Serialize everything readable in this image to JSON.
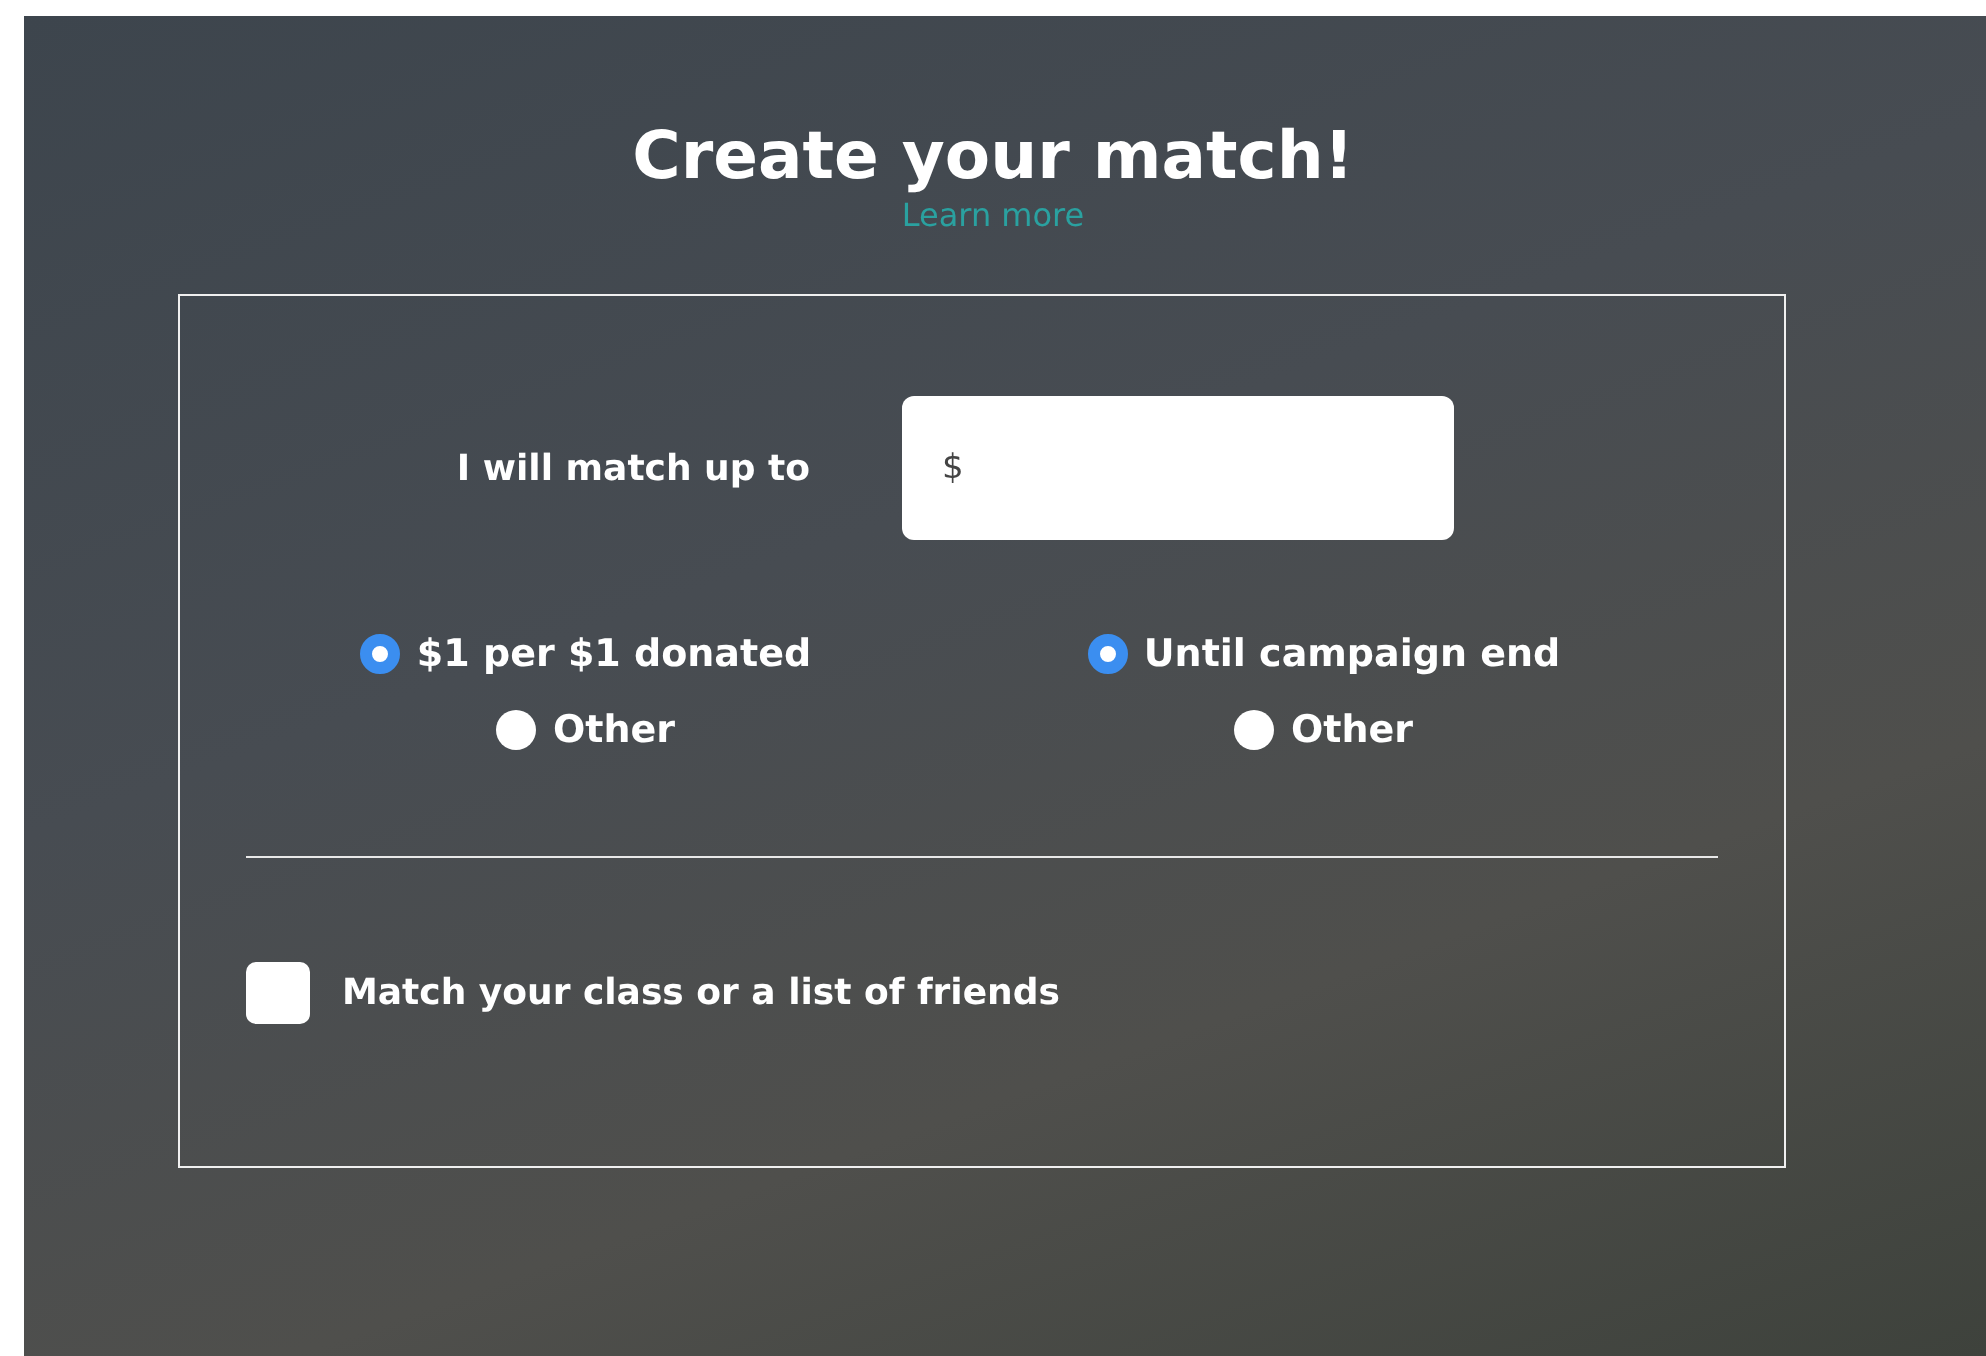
{
  "title": "Create your match!",
  "learn_more": "Learn more",
  "amount": {
    "label": "I will match up to",
    "placeholder": "$"
  },
  "radio_groups": [
    {
      "options": [
        {
          "label": "$1 per $1 donated",
          "selected": true
        },
        {
          "label": "Other",
          "selected": false
        }
      ]
    },
    {
      "options": [
        {
          "label": "Until campaign end",
          "selected": true
        },
        {
          "label": "Other",
          "selected": false
        }
      ]
    }
  ],
  "class_option": {
    "label": "Match your class or a list of friends",
    "checked": false
  }
}
